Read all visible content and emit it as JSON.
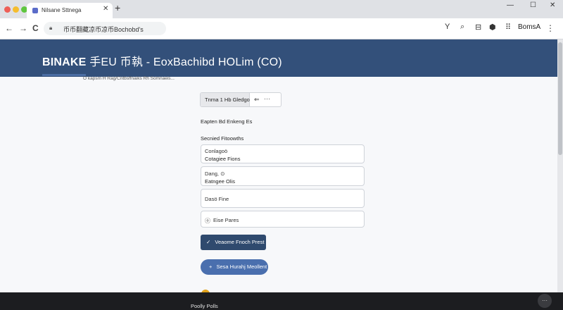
{
  "browser": {
    "colors": {
      "close": "#ee5f57",
      "minimize": "#f5bd2e",
      "maximize": "#5fc63f"
    },
    "tab": {
      "title": "Nilsane Sttnega",
      "close_glyph": "✕"
    },
    "new_tab_glyph": "+",
    "window": {
      "minimize_glyph": "—",
      "maximize_glyph": "☐",
      "close_glyph": "✕"
    },
    "nav": {
      "back_glyph": "←",
      "forward_glyph": "→",
      "reload_glyph": "C"
    },
    "url": "币币翻藏凉币凉币Bochobd's",
    "toolbar_icons": [
      {
        "name": "filter-icon",
        "glyph": "Y"
      },
      {
        "name": "search-icon",
        "glyph": "⌕"
      },
      {
        "name": "bookmark-icon",
        "glyph": "⊟"
      },
      {
        "name": "extension-icon",
        "glyph": "⬢"
      },
      {
        "name": "apps-grid-icon",
        "glyph": "⠿"
      }
    ],
    "profile_label": "BomsA"
  },
  "header": {
    "title_bold": "BINAKE",
    "title_rest": " 手EU 币執 - EoxBachibd HOLim (CO)"
  },
  "breadcrumb": "O kapsm H Rag/Cntbsffnaiks Rh Somnaeis...",
  "segmented": {
    "label": "Tnrna 1 Hb Gledgo",
    "icon_glyph": "⇐",
    "more_glyph": "···"
  },
  "label_primary": "Eapten Bd Enkeng Es",
  "label_section": "Secnied Fitoowths",
  "fields": [
    {
      "line1": "Conlagoö",
      "line2": "Cotagiee Fions"
    },
    {
      "line1": "Dang, ⊙",
      "line2": "Eatngee Olis"
    },
    {
      "text": "Dasö Fine"
    },
    {
      "icon": "ⓞ",
      "text": "Eise Pares"
    }
  ],
  "buttons": {
    "primary": {
      "icon": "✓",
      "label": "Veaome Fnoch Prest"
    },
    "secondary": {
      "icon": "+",
      "label": "Sesa Hurahj Meollent"
    }
  },
  "footer": {
    "text": "Poolly Polls",
    "more_glyph": "···"
  }
}
